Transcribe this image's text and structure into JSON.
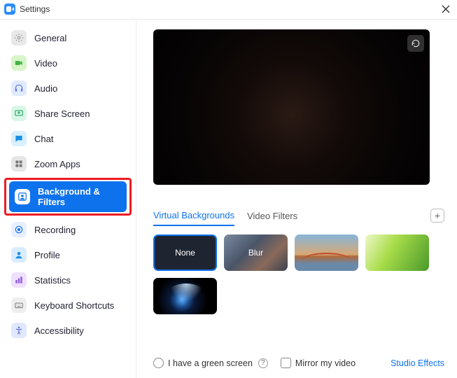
{
  "window": {
    "title": "Settings"
  },
  "sidebar": {
    "items": [
      {
        "label": "General"
      },
      {
        "label": "Video"
      },
      {
        "label": "Audio"
      },
      {
        "label": "Share Screen"
      },
      {
        "label": "Chat"
      },
      {
        "label": "Zoom Apps"
      },
      {
        "label": "Background & Filters"
      },
      {
        "label": "Recording"
      },
      {
        "label": "Profile"
      },
      {
        "label": "Statistics"
      },
      {
        "label": "Keyboard Shortcuts"
      },
      {
        "label": "Accessibility"
      }
    ]
  },
  "main": {
    "tabs": {
      "virtual": "Virtual Backgrounds",
      "filters": "Video Filters"
    },
    "tiles": {
      "none": "None",
      "blur": "Blur"
    },
    "checkboxes": {
      "green_screen": "I have a green screen",
      "mirror": "Mirror my video"
    },
    "studio_effects": "Studio Effects"
  }
}
